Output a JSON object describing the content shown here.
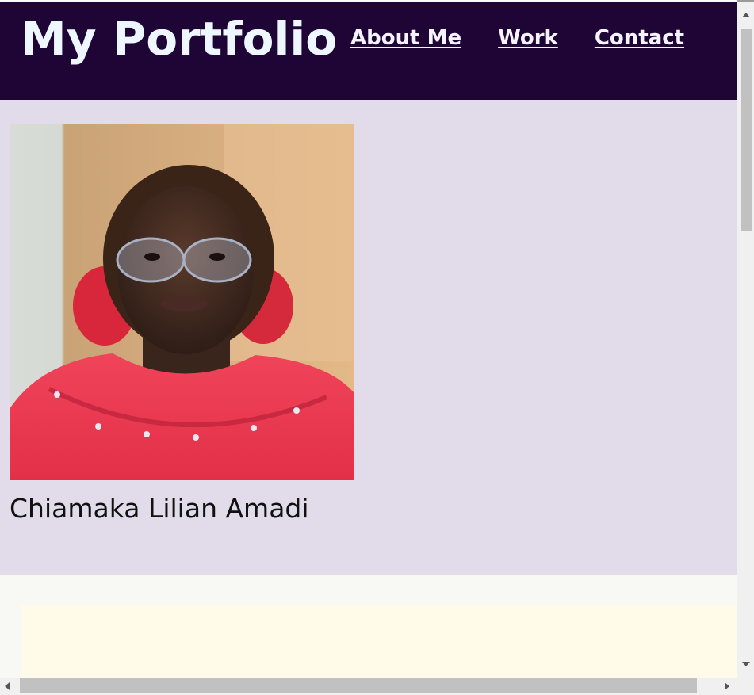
{
  "header": {
    "title": "My Portfolio",
    "nav": [
      {
        "label": "About Me"
      },
      {
        "label": "Work"
      },
      {
        "label": "Contact"
      }
    ]
  },
  "profile": {
    "name": "Chiamaka Lilian Amadi",
    "photo_icon": "portrait-photo"
  },
  "colors": {
    "header_bg": "#1f0536",
    "profile_bg": "#e2dcea",
    "card_bg": "#fffbe8",
    "page_bg": "#fafaf7"
  }
}
